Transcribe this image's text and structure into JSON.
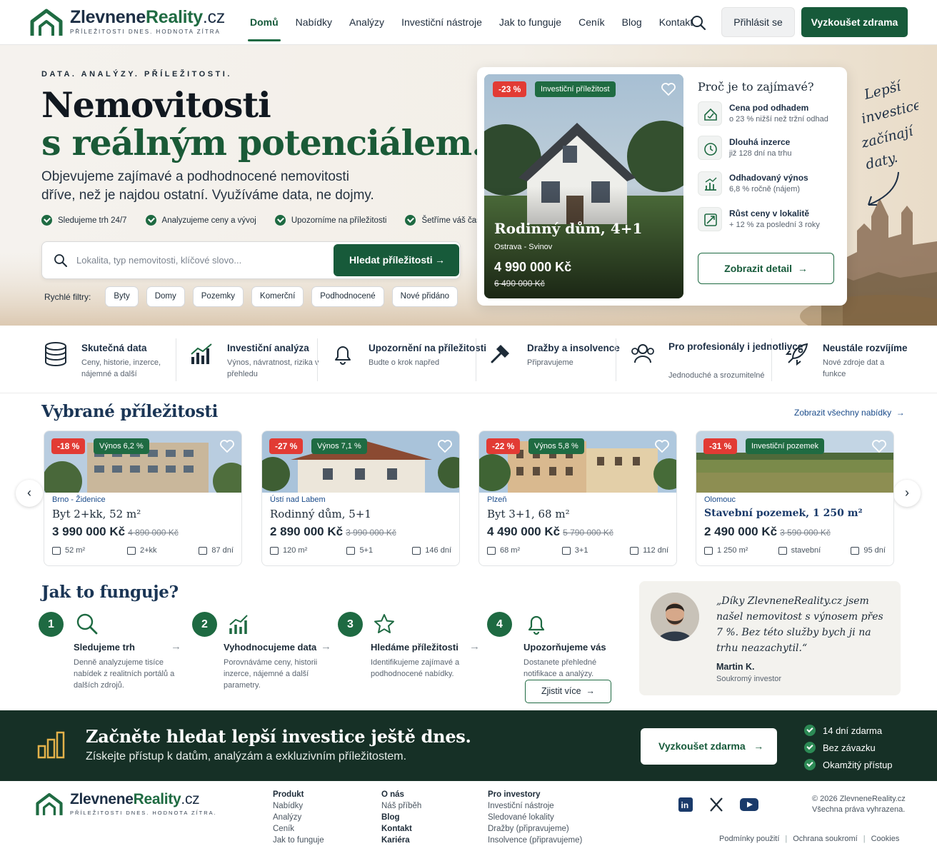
{
  "brand": {
    "name_a": "Zlevnene",
    "name_b": "Reality",
    "name_c": ".cz",
    "tagline": "PŘÍLEŽITOSTI DNES. HODNOTA ZÍTRA",
    "footer_tagline": "PŘÍLEŽITOSTI DNES. HODNOTA ZÍTRA.",
    "color_primary": "#175a3a"
  },
  "nav": {
    "items": [
      "Domů",
      "Nabídky",
      "Analýzy",
      "Investiční nástroje",
      "Jak to funguje",
      "Ceník",
      "Blog",
      "Kontakt"
    ],
    "active": "Domů",
    "login": "Přihlásit se",
    "try": "Vyzkoušet zdrama"
  },
  "hero": {
    "eyebrow": "DATA. ANALÝZY. PŘÍLEŽITOSTI.",
    "title_line1": "Nemovitosti",
    "title_line2": "s reálným potenciálem.",
    "lead": "Objevujeme zajímavé a podhodnocené nemovitosti dříve, než je najdou ostatní. Využíváme data, ne dojmy.",
    "checks": [
      "Sledujeme trh 24/7",
      "Analyzujeme ceny a vývoj",
      "Upozorníme na příležitosti",
      "Šetříme váš čas"
    ],
    "search_placeholder": "Lokalita, typ nemovitosti, klíčové slovo...",
    "search_button": "Hledat příležitosti",
    "quick_label": "Rychlé filtry:",
    "quick_filters": [
      "Byty",
      "Domy",
      "Pozemky",
      "Komerční",
      "Podhodnocené",
      "Nové přidáno"
    ],
    "handwritten": [
      "Lepší",
      "investice",
      "začínají",
      "daty."
    ]
  },
  "featured": {
    "discount": "-23 %",
    "tag": "Investiční příležitost",
    "name": "Rodinný dům, 4+1",
    "location": "Ostrava - Svinov",
    "price": "4 990 000 Kč",
    "old_price": "6 490 000 Kč",
    "why_title": "Proč je to zajímavé?",
    "reasons": [
      {
        "title": "Cena pod odhadem",
        "sub": "o 23 % nižší než tržní odhad",
        "icon": "price-tag-icon"
      },
      {
        "title": "Dlouhá inzerce",
        "sub": "již 128 dní na trhu",
        "icon": "alarm-clock-icon"
      },
      {
        "title": "Odhadovaný výnos",
        "sub": "6,8 % ročně (nájem)",
        "icon": "yield-chart-icon"
      },
      {
        "title": "Růst ceny v lokalitě",
        "sub": "+ 12 % za poslední 3 roky",
        "icon": "growth-icon"
      }
    ],
    "detail_button": "Zobrazit detail"
  },
  "features": [
    {
      "title": "Skutečná data",
      "sub": "Ceny, historie, inzerce, nájemné a další",
      "icon": "database-icon"
    },
    {
      "title": "Investiční analýza",
      "sub": "Výnos, návratnost, rizika v přehledu",
      "icon": "bar-chart-icon"
    },
    {
      "title": "Upozornění na příležitosti",
      "sub": "Budte o krok napřed",
      "icon": "bell-icon"
    },
    {
      "title": "Dražby a insolvence",
      "sub": "Připravujeme",
      "icon": "gavel-icon"
    },
    {
      "title": "Pro profesionály i jednotlivce",
      "sub": "Jednoduché a srozumitelné",
      "icon": "users-icon"
    },
    {
      "title": "Neustále rozvíjíme",
      "sub": "Nové zdroje dat a funkce",
      "icon": "rocket-icon"
    }
  ],
  "opportunities": {
    "title": "Vybrané příležitosti",
    "see_all": "Zobrazit všechny nabídky",
    "items": [
      {
        "discount": "-18 %",
        "tag": "Výnos 6,2 %",
        "location": "Brno - Židenice",
        "title": "Byt 2+kk, 52 m²",
        "price": "3 990 000 Kč",
        "old": "4 890 000 Kč",
        "m1": "52 m²",
        "m2": "2+kk",
        "m3": "87 dní"
      },
      {
        "discount": "-27 %",
        "tag": "Výnos 7,1 %",
        "location": "Ústí nad Labem",
        "title": "Rodinný dům, 5+1",
        "price": "2 890 000 Kč",
        "old": "3 990 000 Kč",
        "m1": "120 m²",
        "m2": "5+1",
        "m3": "146 dní"
      },
      {
        "discount": "-22 %",
        "tag": "Výnos 5,8 %",
        "location": "Plzeň",
        "title": "Byt 3+1, 68 m²",
        "price": "4 490 000 Kč",
        "old": "5 790 000 Kč",
        "m1": "68 m²",
        "m2": "3+1",
        "m3": "112 dní"
      },
      {
        "discount": "-31 %",
        "tag": "Investiční pozemek",
        "location": "Olomouc",
        "title": "Stavební pozemek, 1 250 m²",
        "price": "2 490 000 Kč",
        "old": "3 590 000 Kč",
        "m1": "1 250 m²",
        "m2": "stavební",
        "m3": "95 dní"
      }
    ]
  },
  "how": {
    "title": "Jak to funguje?",
    "steps": [
      {
        "n": "1",
        "title": "Sledujeme trh",
        "sub": "Denně analyzujeme tisíce nabídek z realitních portálů a dalších zdrojů.",
        "icon": "magnifier-icon"
      },
      {
        "n": "2",
        "title": "Vyhodnocujeme data",
        "sub": "Porovnáváme ceny, historii inzerce, nájemné a další parametry.",
        "icon": "bar-chart-icon"
      },
      {
        "n": "3",
        "title": "Hledáme příležitosti",
        "sub": "Identifikujeme zajímavé a podhodnocené nabídky.",
        "icon": "star-icon"
      },
      {
        "n": "4",
        "title": "Upozorňujeme vás",
        "sub": "Dostanete přehledné notifikace a analýzy.",
        "icon": "bell-icon"
      }
    ],
    "more_button": "Zjistit více"
  },
  "testimonial": {
    "quote": "„Díky ZlevneneReality.cz jsem našel nemovitost s výnosem přes 7 %. Bez této služby bych ji na trhu neazachytil.“",
    "name": "Martin K.",
    "role": "Soukromý investor"
  },
  "cta": {
    "title": "Začněte hledat lepší investice ještě dnes.",
    "sub": "Získejte přístup k datům, analýzám a exkluzivním příležitostem.",
    "button": "Vyzkoušet zdarma",
    "perks": [
      "14 dní zdarma",
      "Bez závazku",
      "Okamžitý přístup"
    ]
  },
  "footer": {
    "col1": {
      "head": "Produkt",
      "items": [
        "Nabídky",
        "Analýzy",
        "Ceník",
        "Jak to funguje"
      ]
    },
    "col2": {
      "head": "O nás",
      "items": [
        "Náš příběh",
        "Blog",
        "Kontakt",
        "Kariéra"
      ]
    },
    "col3": {
      "head": "Pro investory",
      "items": [
        "Investiční nástroje",
        "Sledované lokality",
        "Dražby (připravujeme)",
        "Insolvence (připravujeme)"
      ]
    },
    "social": [
      "linkedin-icon",
      "x-icon",
      "youtube-icon"
    ],
    "copyright": "© 2026 ZlevneneReality.cz",
    "rights": "Všechna práva vyhrazena.",
    "legal": [
      "Podmínky použití",
      "Ochrana soukromí",
      "Cookies"
    ]
  }
}
